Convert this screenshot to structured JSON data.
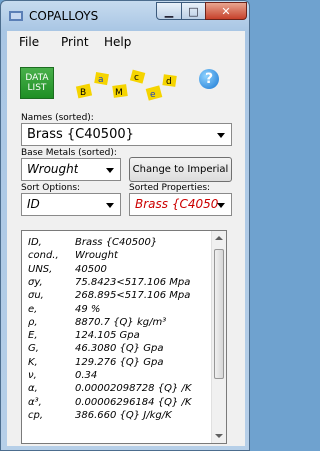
{
  "window": {
    "title": "COPALLOYS"
  },
  "menu": [
    "File",
    "Print",
    "Help"
  ],
  "toolbar": {
    "data_list_line1": "DATA",
    "data_list_line2": "LIST",
    "help_glyph": "?"
  },
  "names": {
    "label": "Names (sorted):",
    "value": "Brass {C40500}"
  },
  "base_metals": {
    "label": "Base Metals (sorted):",
    "value": "Wrought"
  },
  "change_button": "Change to Imperial",
  "sort_options": {
    "label": "Sort Options:",
    "value": "ID"
  },
  "sorted_properties": {
    "label": "Sorted Properties:",
    "value": "Brass {C40500}",
    "color": "#cc0000"
  },
  "properties": [
    {
      "name": "ID,",
      "value": "Brass {C40500}"
    },
    {
      "name": "cond.,",
      "value": "Wrought"
    },
    {
      "name": "UNS,",
      "value": "40500"
    },
    {
      "name": "σy,",
      "value": "75.8423<517.106 Mpa"
    },
    {
      "name": "σu,",
      "value": "268.895<517.106 Mpa"
    },
    {
      "name": "e,",
      "value": "49 %"
    },
    {
      "name": "ρ,",
      "value": "8870.7 {Q} kg/m³"
    },
    {
      "name": "E,",
      "value": "124.105 Gpa"
    },
    {
      "name": "G,",
      "value": "46.3080 {Q} Gpa"
    },
    {
      "name": "K,",
      "value": "129.276 {Q} Gpa"
    },
    {
      "name": "ν,",
      "value": "0.34"
    },
    {
      "name": "α,",
      "value": "0.00002098728 {Q} /K"
    },
    {
      "name": "α³,",
      "value": "0.00006296184 {Q} /K"
    },
    {
      "name": "cp,",
      "value": "386.660 {Q} J/kg/K"
    }
  ],
  "blocks": [
    "B",
    "a",
    "M",
    "c",
    "e",
    "d"
  ]
}
